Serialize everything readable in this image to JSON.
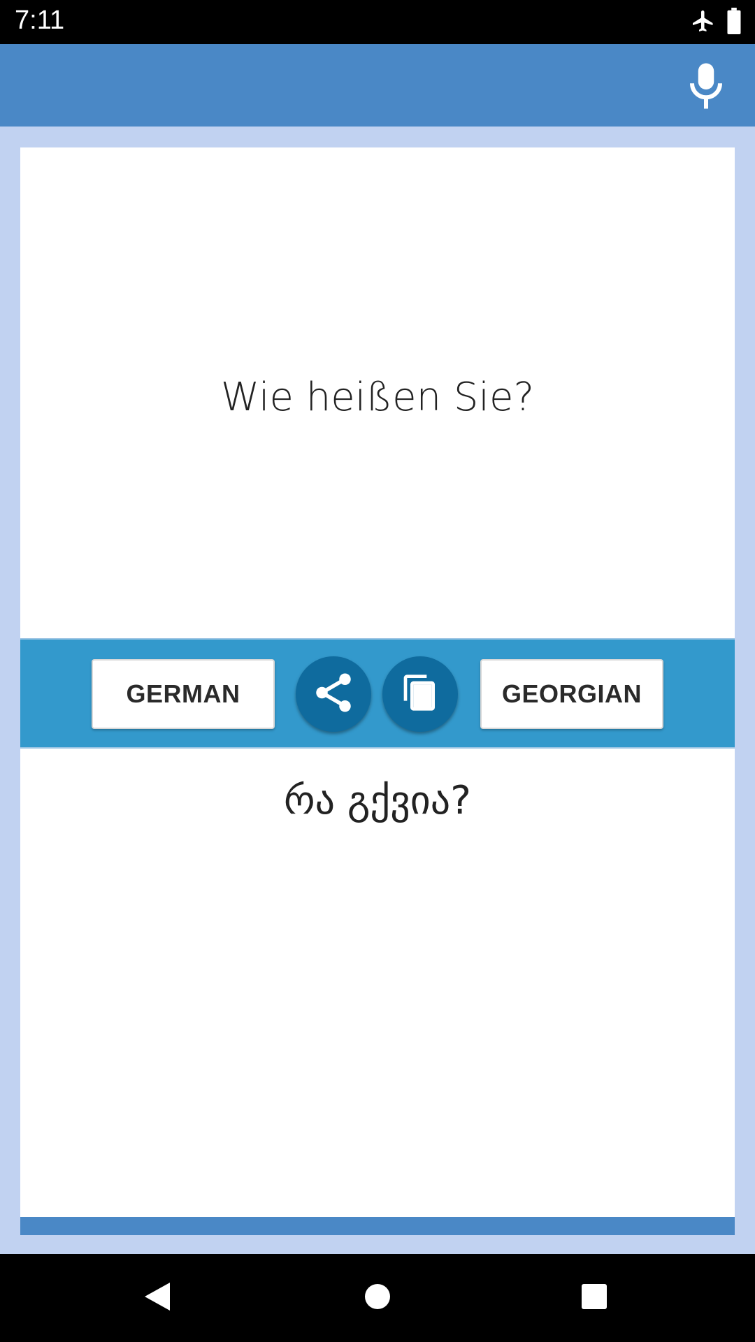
{
  "status_bar": {
    "time": "7:11",
    "icons": [
      "airplane-mode-icon",
      "battery-icon"
    ]
  },
  "app_bar": {
    "icons": [
      "microphone-icon"
    ],
    "color": "#4a88c6"
  },
  "translator": {
    "source_text": "Wie heißen Sie?",
    "target_text": "რა გქვია?",
    "source_language_label": "GERMAN",
    "target_language_label": "GEORGIAN",
    "icons": [
      "share-icon",
      "copy-icon"
    ],
    "control_bar_color": "#3399cc",
    "round_button_color": "#0f6b9e",
    "background_color": "#c1d2f1"
  },
  "nav_bar": {
    "icons": [
      "back-icon",
      "home-icon",
      "recents-icon"
    ]
  }
}
